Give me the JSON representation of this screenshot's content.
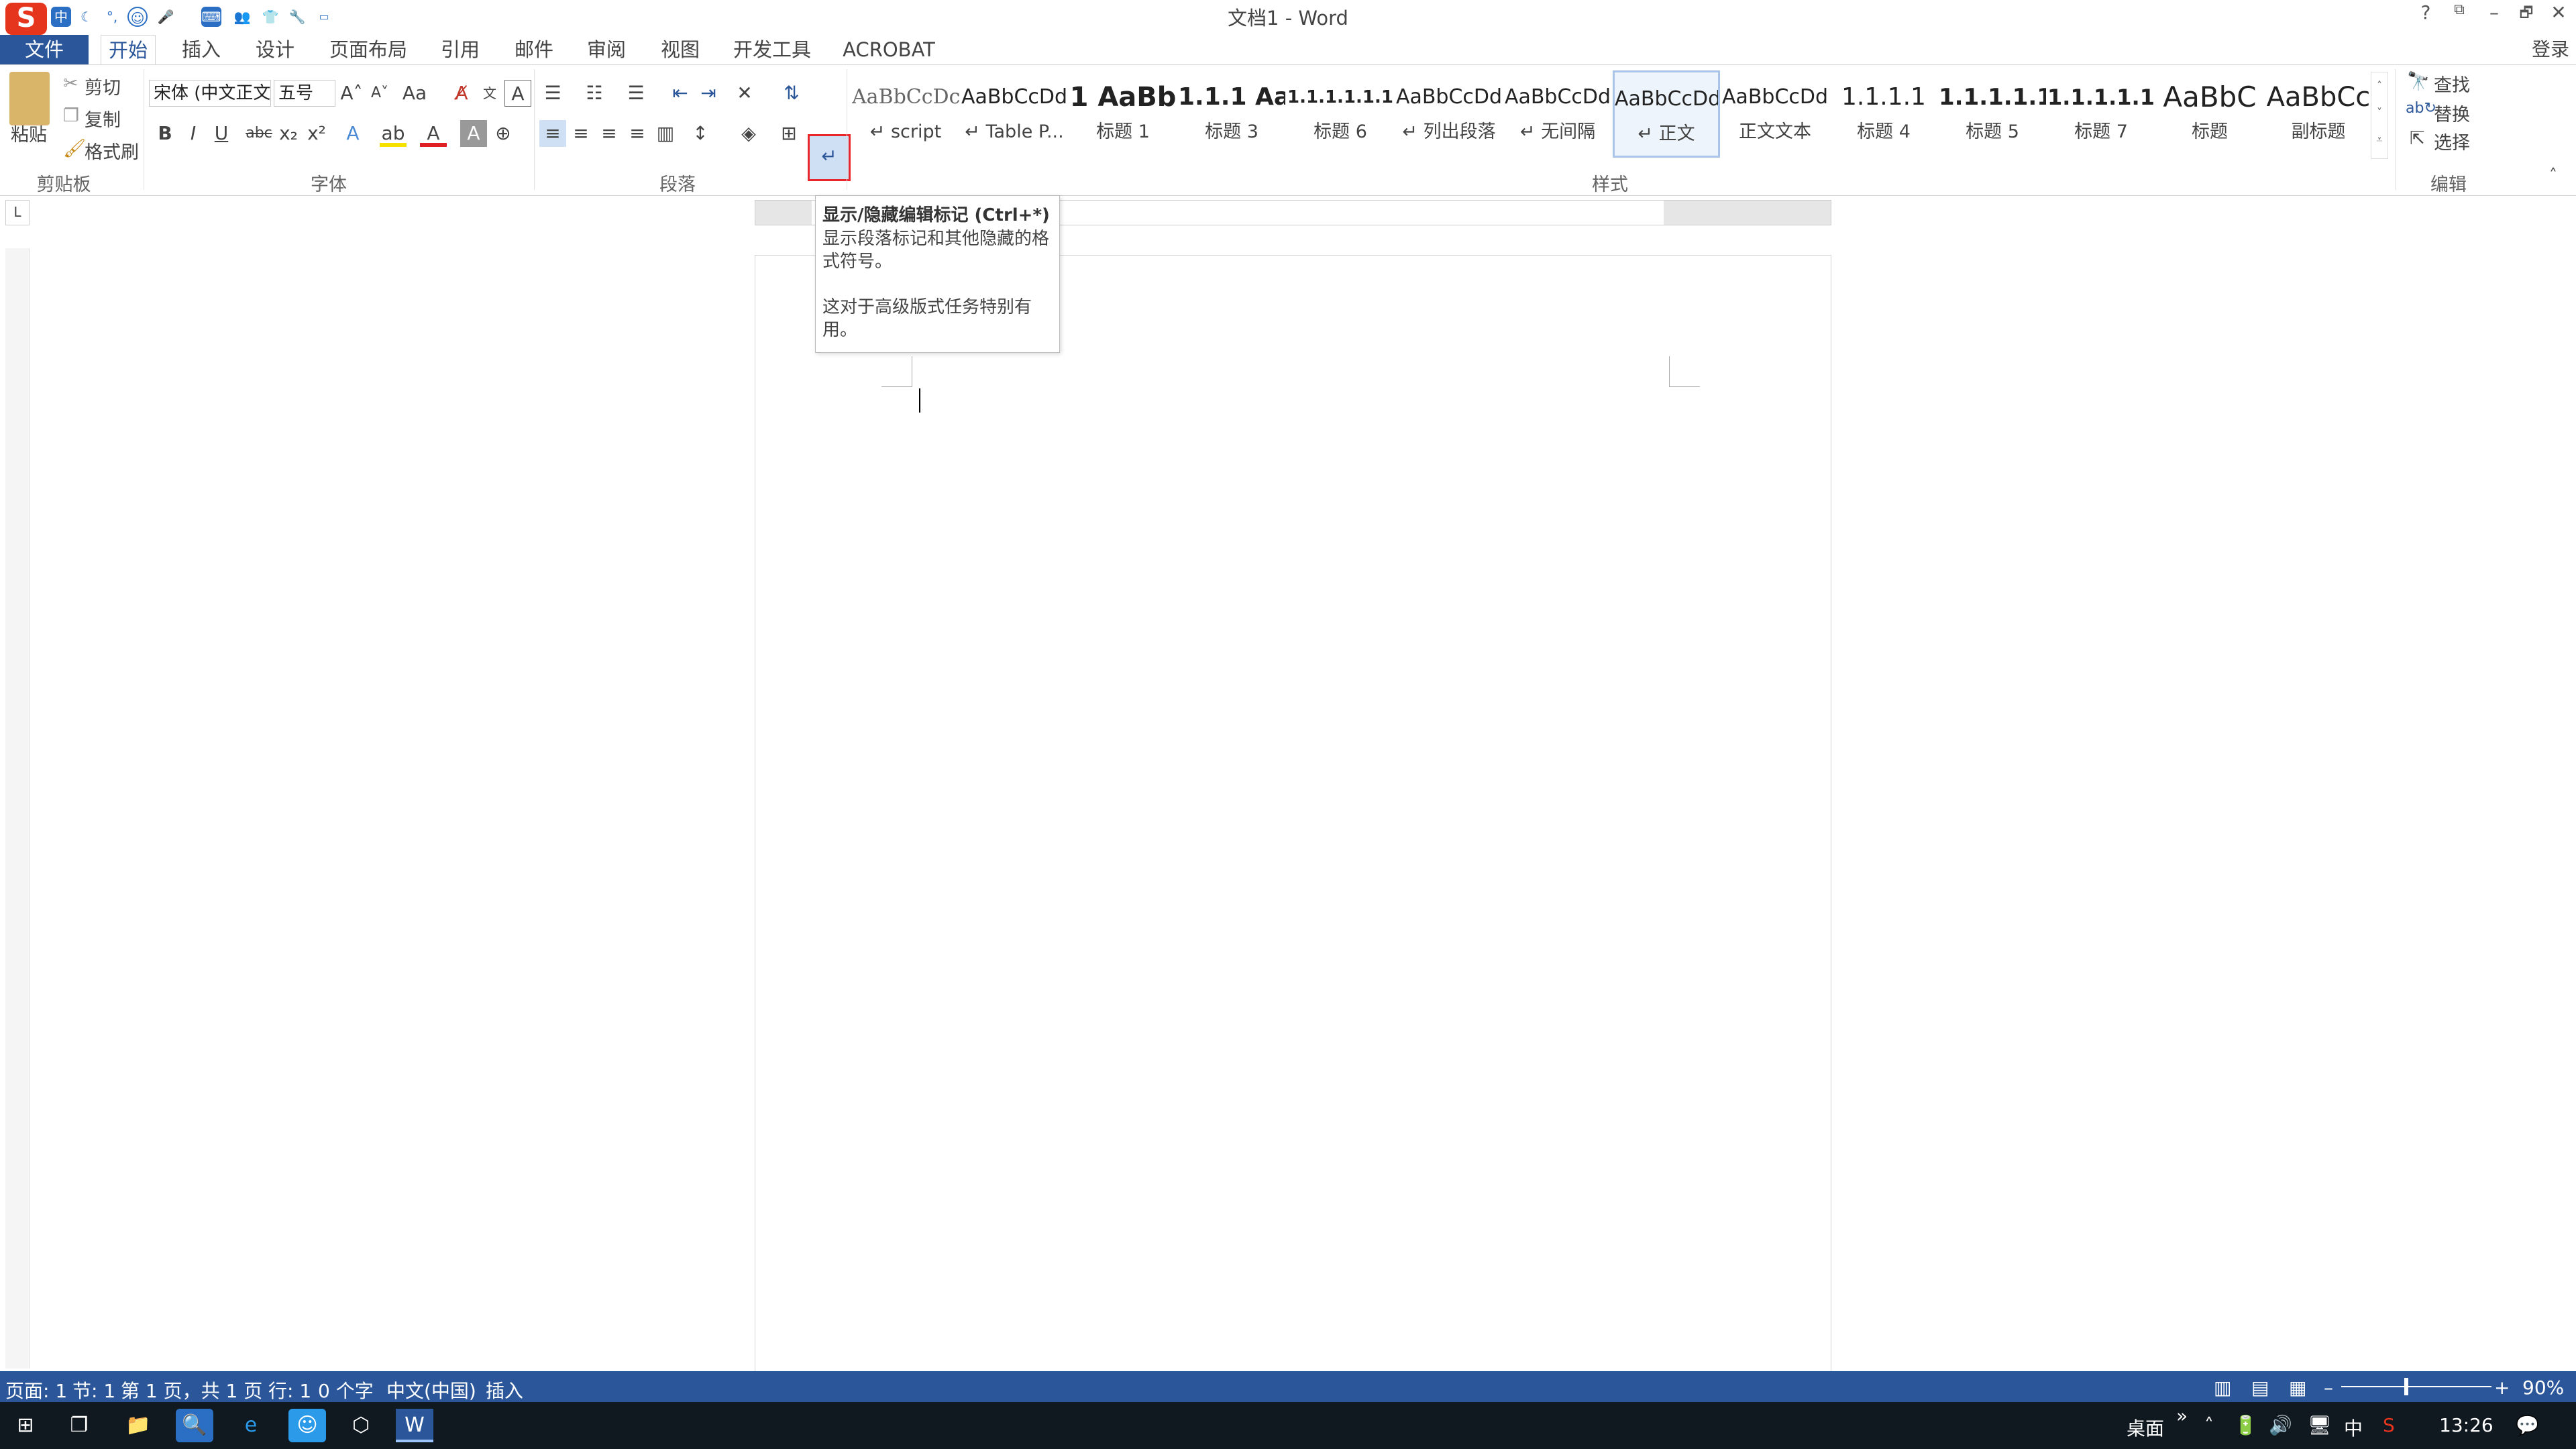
{
  "app": {
    "window_title": "文档1 - Word"
  },
  "quick_access": {
    "icons": [
      "sogou-logo-icon",
      "chinese-mode-icon",
      "moon-icon",
      "punctuation-icon",
      "emoji-icon",
      "mic-icon",
      "keyboard-icon",
      "toolbox-icon",
      "skin-icon",
      "settings-icon",
      "screen-icon"
    ],
    "ime_mode": "中"
  },
  "window_controls": {
    "help": "?",
    "restore_ribbon": "⧉",
    "minimize": "–",
    "maximize": "🗗",
    "close": "✕"
  },
  "tabs": {
    "file": "文件",
    "home": "开始",
    "insert": "插入",
    "design": "设计",
    "layout": "页面布局",
    "references": "引用",
    "mailings": "邮件",
    "review": "审阅",
    "view": "视图",
    "developer": "开发工具",
    "acrobat": "ACROBAT"
  },
  "login": "登录",
  "clipboard": {
    "paste": "粘贴",
    "cut": "剪切",
    "copy": "复制",
    "format_painter": "格式刷",
    "group": "剪贴板"
  },
  "font": {
    "name": "宋体 (中文正文)",
    "size": "五号",
    "group": "字体"
  },
  "paragraph": {
    "group": "段落"
  },
  "styles": {
    "group": "样式",
    "items": [
      {
        "preview": "AaBbCcDc",
        "name": "↵ script"
      },
      {
        "preview": "AaBbCcDd",
        "name": "↵ Table P..."
      },
      {
        "preview": "1  AaBb",
        "name": "标题 1"
      },
      {
        "preview": "1.1.1  Aa",
        "name": "标题 3"
      },
      {
        "preview": "1.1.1.1.1.1",
        "name": "标题 6"
      },
      {
        "preview": "AaBbCcDd",
        "name": "↵ 列出段落"
      },
      {
        "preview": "AaBbCcDd",
        "name": "↵ 无间隔"
      },
      {
        "preview": "AaBbCcDd",
        "name": "↵ 正文"
      },
      {
        "preview": "AaBbCcDd",
        "name": "正文文本"
      },
      {
        "preview": "1.1.1.1",
        "name": "标题 4"
      },
      {
        "preview": "1.1.1.1.1",
        "name": "标题 5"
      },
      {
        "preview": "1.1.1.1.1.",
        "name": "标题 7"
      },
      {
        "preview": "AaBbC",
        "name": "标题"
      },
      {
        "preview": "AaBbCc",
        "name": "副标题"
      }
    ]
  },
  "editing": {
    "find": "查找",
    "replace": "替换",
    "select": "选择",
    "group": "编辑"
  },
  "tooltip": {
    "title": "显示/隐藏编辑标记 (Ctrl+*)",
    "desc": "显示段落标记和其他隐藏的格式符号。",
    "note": "这对于高级版式任务特别有用。"
  },
  "status": {
    "page": "页面: 1",
    "section": "节: 1",
    "pages": "第 1 页，共 1 页",
    "line": "行: 1",
    "words": "0 个字",
    "language": "中文(中国)",
    "mode": "插入",
    "zoom": "90%"
  },
  "taskbar": {
    "desktop": "桌面",
    "ime": "中",
    "time": "13:26"
  },
  "colors": {
    "accent": "#2b579a",
    "highlight_box": "#e8262b",
    "taskbar": "#101820"
  }
}
